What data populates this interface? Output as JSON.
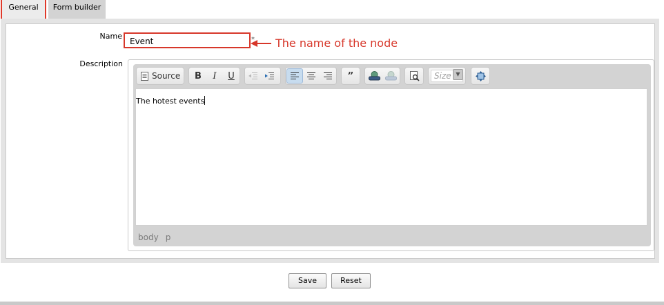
{
  "tabs": [
    {
      "label": "General",
      "active": true
    },
    {
      "label": "Form builder",
      "active": false
    }
  ],
  "form": {
    "name_label": "Name",
    "name_value": "Event",
    "required_marker": "*",
    "description_label": "Description"
  },
  "annotation": {
    "text": "The name of the node",
    "color": "#d7372a"
  },
  "editor": {
    "toolbar": {
      "source_label": "Source",
      "size_placeholder": "Size"
    },
    "content": "The hotest events",
    "path": [
      "body",
      "p"
    ]
  },
  "buttons": {
    "save": "Save",
    "reset": "Reset"
  }
}
